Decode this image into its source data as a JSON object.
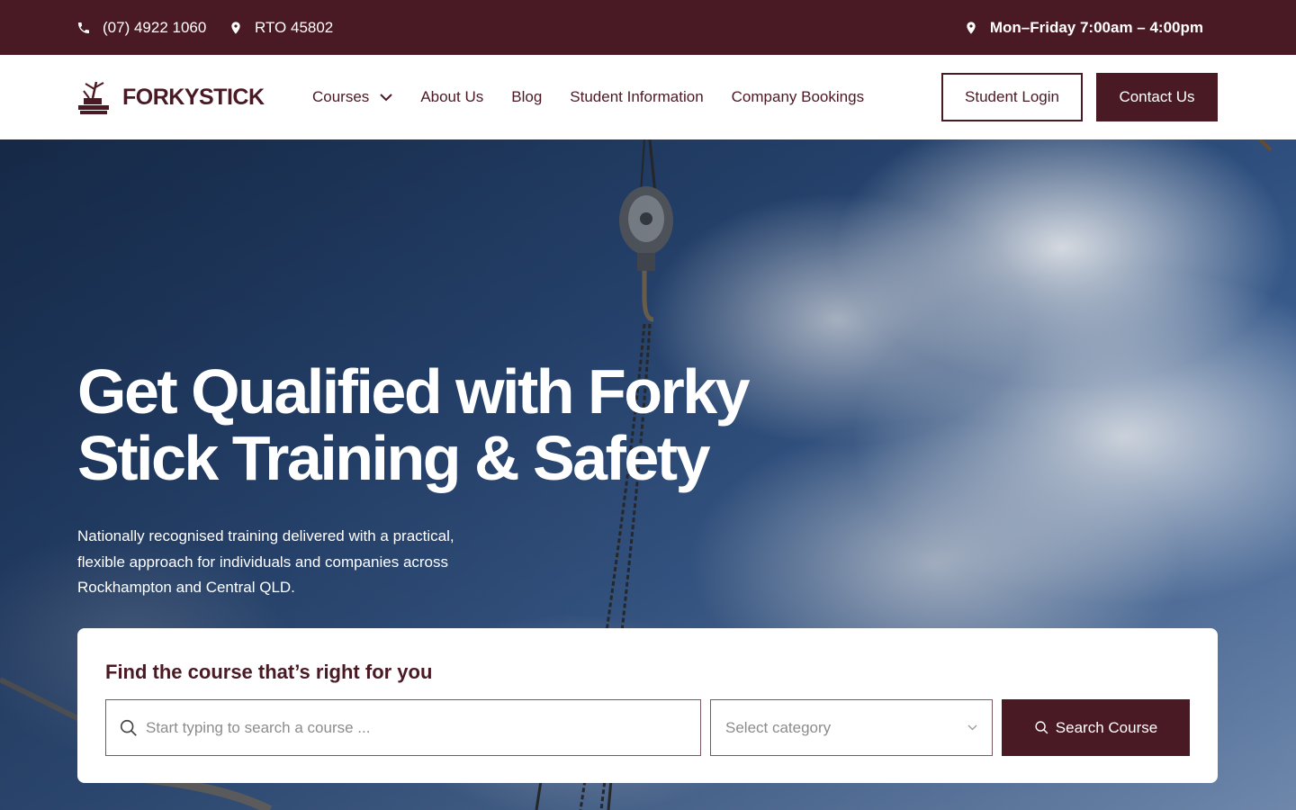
{
  "colors": {
    "brand": "#4a1a24",
    "white": "#ffffff"
  },
  "topbar": {
    "phone": "(07) 4922 1060",
    "rto": "RTO 45802",
    "hours": "Mon–Friday 7:00am – 4:00pm",
    "phone_icon": "phone-icon",
    "location_icon": "map-pin-icon"
  },
  "header": {
    "logo_text": "FORKYSTICK",
    "nav": {
      "courses": "Courses",
      "about": "About Us",
      "blog": "Blog",
      "student_info": "Student Information",
      "company_bookings": "Company Bookings"
    },
    "student_login": "Student Login",
    "contact": "Contact Us"
  },
  "hero": {
    "title_line1": "Get Qualified with Forky",
    "title_line2": "Stick Training & Safety",
    "subtitle": "Nationally recognised training delivered with a practical, flexible approach for individuals and companies across Rockhampton and Central QLD."
  },
  "search": {
    "title": "Find the course that’s right for you",
    "placeholder": "Start typing to search a course ...",
    "category_placeholder": "Select category",
    "button_label": "Search Course"
  }
}
